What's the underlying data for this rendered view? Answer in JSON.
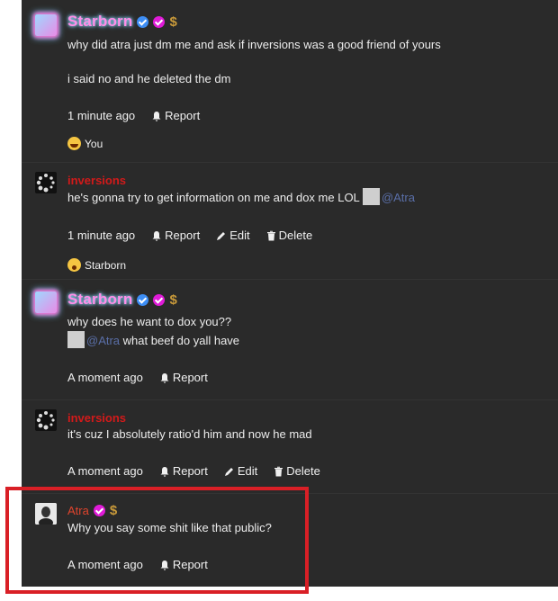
{
  "posts": [
    {
      "author": "Starborn",
      "badges": [
        "verified-badge-icon",
        "pink-check-badge-icon",
        "dollar-icon"
      ],
      "dollar": "$",
      "lines": [
        "why did atra just dm me and ask if inversions was a good friend of yours",
        "i said no and he deleted the dm"
      ],
      "time": "1 minute ago",
      "report": "Report",
      "reaction": "You"
    },
    {
      "author": "inversions",
      "line": "he's gonna try to get information on me and dox me LOL",
      "mention": "@Atra",
      "time": "1 minute ago",
      "report": "Report",
      "edit": "Edit",
      "delete": "Delete",
      "reaction": "Starborn"
    },
    {
      "author": "Starborn",
      "dollar": "$",
      "line1": "why does he want to dox you??",
      "mention": "@Atra",
      "line2": "what beef do yall have",
      "time": "A moment ago",
      "report": "Report"
    },
    {
      "author": "inversions",
      "line": "it's cuz I absolutely ratio'd him and now he mad",
      "time": "A moment ago",
      "report": "Report",
      "edit": "Edit",
      "delete": "Delete"
    },
    {
      "author": "Atra",
      "dollar": "$",
      "line": "Why you say some shit like that public?",
      "time": "A moment ago",
      "report": "Report"
    }
  ],
  "colors": {
    "background": "#2a2a2a",
    "starborn_name": "#ff8ee8",
    "inversions_name": "#d21a1a",
    "atra_name": "#e0442d",
    "mention": "#5a6fa8",
    "highlight": "#d91f26"
  }
}
